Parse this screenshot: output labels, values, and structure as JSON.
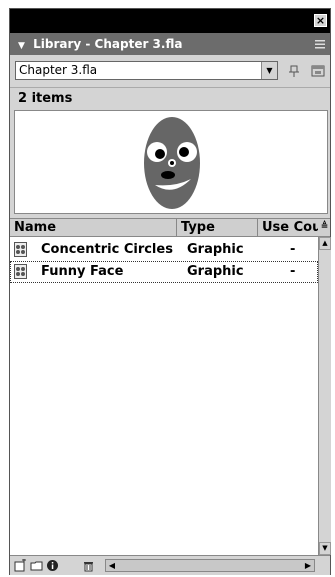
{
  "panel": {
    "title": "Library - Chapter 3.fla",
    "close_glyph": "×"
  },
  "library_select": {
    "value": "Chapter 3.fla"
  },
  "item_count": "2 items",
  "columns": {
    "name": "Name",
    "type": "Type",
    "use_count": "Use Cour"
  },
  "items": [
    {
      "name": "Concentric Circles",
      "type": "Graphic",
      "use_count": "-"
    },
    {
      "name": "Funny Face",
      "type": "Graphic",
      "use_count": "-"
    }
  ],
  "colors": {
    "titlebar": "#6c6c6c",
    "panel_bg": "#d4d4d4",
    "face": "#666666"
  }
}
